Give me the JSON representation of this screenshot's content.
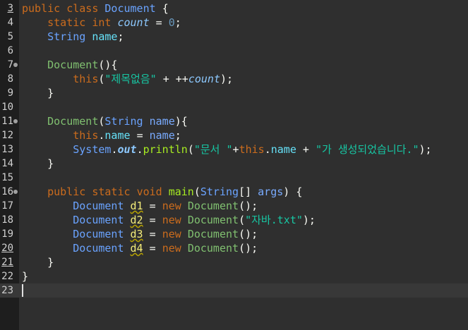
{
  "editor": {
    "lines": [
      {
        "n": "3",
        "tokens": [
          [
            "kw",
            "public"
          ],
          [
            "",
            " "
          ],
          [
            "kw",
            "class"
          ],
          [
            "",
            " "
          ],
          [
            "cls",
            "Document"
          ],
          [
            "",
            " "
          ],
          [
            "punct",
            "{"
          ]
        ]
      },
      {
        "n": "4",
        "tokens": [
          [
            "",
            "    "
          ],
          [
            "kw",
            "static"
          ],
          [
            "",
            " "
          ],
          [
            "kw",
            "int"
          ],
          [
            "",
            " "
          ],
          [
            "sfield",
            "count"
          ],
          [
            "",
            " "
          ],
          [
            "punct",
            "="
          ],
          [
            "",
            " "
          ],
          [
            "num",
            "0"
          ],
          [
            "punct",
            ";"
          ]
        ]
      },
      {
        "n": "5",
        "tokens": [
          [
            "",
            "    "
          ],
          [
            "cls",
            "String"
          ],
          [
            "",
            " "
          ],
          [
            "fld",
            "name"
          ],
          [
            "punct",
            ";"
          ]
        ]
      },
      {
        "n": "6",
        "tokens": []
      },
      {
        "n": "7",
        "tokens": [
          [
            "",
            "    "
          ],
          [
            "ctor",
            "Document"
          ],
          [
            "punct",
            "(){"
          ]
        ]
      },
      {
        "n": "8",
        "tokens": [
          [
            "",
            "        "
          ],
          [
            "kw",
            "this"
          ],
          [
            "punct",
            "("
          ],
          [
            "str",
            "\"제목없음\""
          ],
          [
            "",
            " "
          ],
          [
            "punct",
            "+"
          ],
          [
            "",
            " "
          ],
          [
            "punct",
            "++"
          ],
          [
            "sfield",
            "count"
          ],
          [
            "punct",
            ");"
          ]
        ]
      },
      {
        "n": "9",
        "tokens": [
          [
            "",
            "    "
          ],
          [
            "punct",
            "}"
          ]
        ]
      },
      {
        "n": "10",
        "tokens": []
      },
      {
        "n": "11",
        "tokens": [
          [
            "",
            "    "
          ],
          [
            "ctor",
            "Document"
          ],
          [
            "punct",
            "("
          ],
          [
            "cls",
            "String"
          ],
          [
            "",
            " "
          ],
          [
            "param",
            "name"
          ],
          [
            "punct",
            "){"
          ]
        ]
      },
      {
        "n": "12",
        "tokens": [
          [
            "",
            "        "
          ],
          [
            "kw",
            "this"
          ],
          [
            "punct",
            "."
          ],
          [
            "fld",
            "name"
          ],
          [
            "",
            " "
          ],
          [
            "punct",
            "="
          ],
          [
            "",
            " "
          ],
          [
            "param",
            "name"
          ],
          [
            "punct",
            ";"
          ]
        ]
      },
      {
        "n": "13",
        "tokens": [
          [
            "",
            "        "
          ],
          [
            "cls",
            "System"
          ],
          [
            "punct",
            "."
          ],
          [
            "sfieldb",
            "out"
          ],
          [
            "punct",
            "."
          ],
          [
            "method",
            "println"
          ],
          [
            "punct",
            "("
          ],
          [
            "str",
            "\"문서 \""
          ],
          [
            "punct",
            "+"
          ],
          [
            "kw",
            "this"
          ],
          [
            "punct",
            "."
          ],
          [
            "fld",
            "name"
          ],
          [
            "",
            " "
          ],
          [
            "punct",
            "+"
          ],
          [
            "",
            " "
          ],
          [
            "str",
            "\"가 생성되었습니다.\""
          ],
          [
            "punct",
            ");"
          ]
        ]
      },
      {
        "n": "14",
        "tokens": [
          [
            "",
            "    "
          ],
          [
            "punct",
            "}"
          ]
        ]
      },
      {
        "n": "15",
        "tokens": []
      },
      {
        "n": "16",
        "tokens": [
          [
            "",
            "    "
          ],
          [
            "kw",
            "public"
          ],
          [
            "",
            " "
          ],
          [
            "kw",
            "static"
          ],
          [
            "",
            " "
          ],
          [
            "kw",
            "void"
          ],
          [
            "",
            " "
          ],
          [
            "method",
            "main"
          ],
          [
            "punct",
            "("
          ],
          [
            "cls",
            "String"
          ],
          [
            "punct",
            "[]"
          ],
          [
            "",
            " "
          ],
          [
            "param",
            "args"
          ],
          [
            "punct",
            ")"
          ],
          [
            "",
            " "
          ],
          [
            "punct",
            "{"
          ]
        ]
      },
      {
        "n": "17",
        "tokens": [
          [
            "",
            "        "
          ],
          [
            "cls",
            "Document"
          ],
          [
            "",
            " "
          ],
          [
            "lvar",
            "d1"
          ],
          [
            "",
            " "
          ],
          [
            "punct",
            "="
          ],
          [
            "",
            " "
          ],
          [
            "kw",
            "new"
          ],
          [
            "",
            " "
          ],
          [
            "ctor",
            "Document"
          ],
          [
            "punct",
            "();"
          ]
        ]
      },
      {
        "n": "18",
        "tokens": [
          [
            "",
            "        "
          ],
          [
            "cls",
            "Document"
          ],
          [
            "",
            " "
          ],
          [
            "lvar",
            "d2"
          ],
          [
            "",
            " "
          ],
          [
            "punct",
            "="
          ],
          [
            "",
            " "
          ],
          [
            "kw",
            "new"
          ],
          [
            "",
            " "
          ],
          [
            "ctor",
            "Document"
          ],
          [
            "punct",
            "("
          ],
          [
            "str",
            "\"자바.txt\""
          ],
          [
            "punct",
            ");"
          ]
        ]
      },
      {
        "n": "19",
        "tokens": [
          [
            "",
            "        "
          ],
          [
            "cls",
            "Document"
          ],
          [
            "",
            " "
          ],
          [
            "lvar",
            "d3"
          ],
          [
            "",
            " "
          ],
          [
            "punct",
            "="
          ],
          [
            "",
            " "
          ],
          [
            "kw",
            "new"
          ],
          [
            "",
            " "
          ],
          [
            "ctor",
            "Document"
          ],
          [
            "punct",
            "();"
          ]
        ]
      },
      {
        "n": "20",
        "tokens": [
          [
            "",
            "        "
          ],
          [
            "cls",
            "Document"
          ],
          [
            "",
            " "
          ],
          [
            "lvar",
            "d4"
          ],
          [
            "",
            " "
          ],
          [
            "punct",
            "="
          ],
          [
            "",
            " "
          ],
          [
            "kw",
            "new"
          ],
          [
            "",
            " "
          ],
          [
            "ctor",
            "Document"
          ],
          [
            "punct",
            "();"
          ]
        ]
      },
      {
        "n": "21",
        "tokens": [
          [
            "",
            "    "
          ],
          [
            "punct",
            "}"
          ]
        ]
      },
      {
        "n": "22",
        "tokens": [
          [
            "punct",
            "}"
          ]
        ]
      },
      {
        "n": "23",
        "tokens": []
      }
    ]
  }
}
